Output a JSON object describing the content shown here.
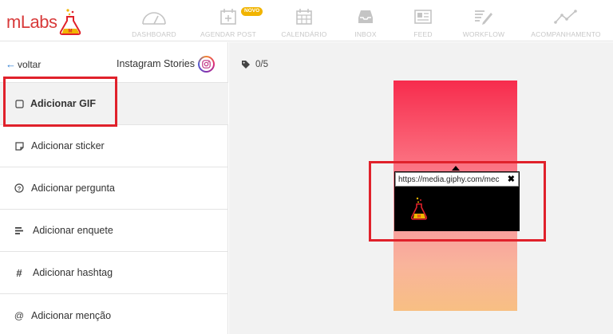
{
  "app": {
    "logo_text": "mLabs"
  },
  "nav": [
    {
      "label": "DASHBOARD",
      "icon": "gauge-icon"
    },
    {
      "label": "AGENDAR POST",
      "icon": "calendar-plus-icon",
      "badge": "NOVO"
    },
    {
      "label": "CALENDÁRIO",
      "icon": "calendar-icon"
    },
    {
      "label": "INBOX",
      "icon": "inbox-icon"
    },
    {
      "label": "FEED",
      "icon": "feed-icon"
    },
    {
      "label": "WORKFLOW",
      "icon": "workflow-icon"
    },
    {
      "label": "ACOMPANHAMENTO",
      "icon": "trend-icon"
    }
  ],
  "sidebar": {
    "back_label": "voltar",
    "title": "Instagram Stories",
    "items": [
      {
        "label": "Adicionar GIF",
        "icon": "square-icon",
        "active": true
      },
      {
        "label": "Adicionar sticker",
        "icon": "sticker-icon"
      },
      {
        "label": "Adicionar pergunta",
        "icon": "question-icon"
      },
      {
        "label": "Adicionar enquete",
        "icon": "poll-icon"
      },
      {
        "label": "Adicionar hashtag",
        "icon": "hashtag-icon"
      },
      {
        "label": "Adicionar menção",
        "icon": "mention-icon"
      }
    ]
  },
  "main": {
    "counter": "0/5",
    "gif": {
      "url": "https://media.giphy.com/mec"
    }
  },
  "colors": {
    "accent": "#e0212b",
    "link": "#2d7dd2",
    "badge": "#f1b400"
  }
}
